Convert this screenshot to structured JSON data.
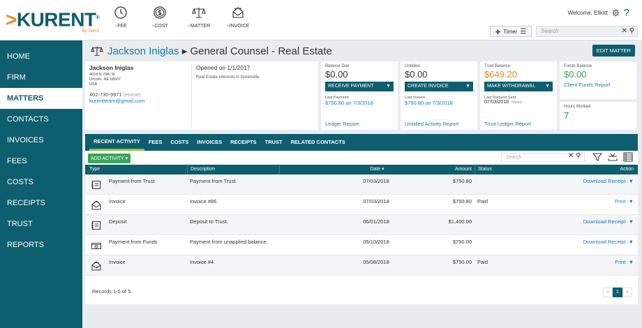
{
  "logo": {
    "name": "KURENT",
    "chevron": ">",
    "tm": "®",
    "sub": "By Tabs3"
  },
  "quick_actions": [
    {
      "icon": "clock-icon",
      "plus": "+",
      "label": "FEE"
    },
    {
      "icon": "dollar-coin-icon",
      "plus": "+",
      "label": "COST"
    },
    {
      "icon": "scale-icon",
      "plus": "+",
      "label": "MATTER"
    },
    {
      "icon": "envelope-icon",
      "plus": "+",
      "label": "INVOICE"
    }
  ],
  "header": {
    "welcome": "Welcome, Elliott",
    "help": "?",
    "timer_label": "Timer",
    "search_placeholder": "Search",
    "search_icons": "✕ ⚲"
  },
  "nav": {
    "items": [
      "HOME",
      "FIRM",
      "MATTERS",
      "CONTACTS",
      "INVOICES",
      "FEES",
      "COSTS",
      "RECEIPTS",
      "TRUST",
      "REPORTS"
    ],
    "active": "MATTERS"
  },
  "matter": {
    "client": "Jackson Iniglas",
    "separator": "▸",
    "name": "General Counsel - Real Estate",
    "edit_label": "EDIT MATTER"
  },
  "client_card": {
    "name": "Jackson Iniglas",
    "address1": "4018 N 70th St",
    "address2": "Lincoln, NE 68507",
    "address3": "USA",
    "phone": "402-730-9971",
    "phone_type": "(Home)",
    "email": "kurentteam@gmail.com",
    "opened": "Opened on 1/1/2017",
    "description": "Real Estate interests in Greenville."
  },
  "finance": {
    "balance": {
      "label": "Balance Due",
      "value": "$0.00",
      "button": "RECEIVE PAYMENT",
      "sub_label": "Last Payment",
      "sub_value": "$750.80 on 7/3/2018",
      "link": "Ledger Report"
    },
    "unbilled": {
      "label": "Unbilled",
      "value": "$0.00",
      "button": "CREATE INVOICE",
      "sub_label": "Last Invoice",
      "sub_value": "$750.80 on 7/3/2018",
      "link": "Unbilled Activity Report"
    },
    "trust": {
      "label": "Trust Balance",
      "value": "$649.20",
      "button": "MAKE WITHDRAWAL",
      "sub_label": "Last Request Sent",
      "sub_value": "07/03/2018",
      "history": "History",
      "link": "Trust Ledger Report"
    },
    "funds": {
      "label": "Funds Balance",
      "value": "$0.00",
      "link": "Client Funds Report"
    },
    "hours": {
      "label": "Hours Worked",
      "value": "7"
    }
  },
  "tabs": [
    "RECENT ACTIVITY",
    "FEES",
    "COSTS",
    "INVOICES",
    "RECEIPTS",
    "TRUST",
    "RELATED CONTACTS"
  ],
  "activity": {
    "add_label": "ADD ACTIVITY ▾",
    "search_placeholder": "Search",
    "columns": {
      "type": "Type",
      "description": "Description",
      "date": "Date ▾",
      "amount": "Amount",
      "status": "Status",
      "action": "Action"
    },
    "rows": [
      {
        "icon": "ledger-icon",
        "type": "Payment from Trust",
        "description": "Payment from Trust.",
        "date": "07/03/2018",
        "amount": "$750.80",
        "status": "",
        "action": "Download Receipt"
      },
      {
        "icon": "invoice-envelope-icon",
        "type": "Invoice",
        "description": "Invoice #86",
        "date": "07/03/2018",
        "amount": "$750.80",
        "status": "Paid",
        "action": "Print"
      },
      {
        "icon": "ledger-icon",
        "type": "Deposit",
        "description": "Deposit to Trust.",
        "date": "06/01/2018",
        "amount": "$1,400.00",
        "status": "",
        "action": "Download Receipt"
      },
      {
        "icon": "cash-icon",
        "type": "Payment from Funds",
        "description": "Payment from unapplied balance.",
        "date": "05/10/2018",
        "amount": "$750.00",
        "status": "",
        "action": "Download Receipt"
      },
      {
        "icon": "invoice-envelope-icon",
        "type": "Invoice",
        "description": "Invoice #4",
        "date": "05/08/2018",
        "amount": "$750.00",
        "status": "Paid",
        "action": "Print"
      }
    ],
    "records": "Records 1-5 of 5",
    "pager": {
      "prev": "«",
      "current": "1",
      "next": "»"
    }
  }
}
